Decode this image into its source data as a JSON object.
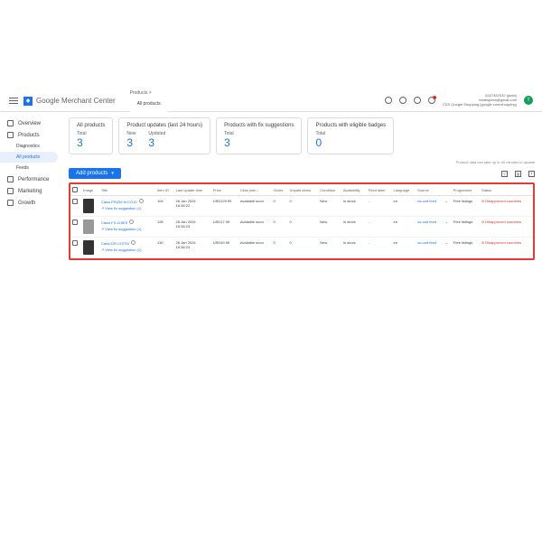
{
  "header": {
    "app_title": "Google Merchant Center",
    "breadcrumb_parent": "Products >",
    "breadcrumb_current": "All products",
    "account_id": "5327452032 (pinta)",
    "account_email": "testespinta@gmail.com",
    "account_program": "CSS Google Shopping (google.com/shopping)",
    "avatar_letter": "T"
  },
  "sidebar": {
    "overview": "Overview",
    "products": "Products",
    "diagnostics": "Diagnostics",
    "all_products": "All products",
    "feeds": "Feeds",
    "performance": "Performance",
    "marketing": "Marketing",
    "growth": "Growth"
  },
  "cards": [
    {
      "title": "All products",
      "cols": [
        {
          "sub": "Total",
          "num": "3"
        }
      ]
    },
    {
      "title": "Product updates (last 24 hours)",
      "cols": [
        {
          "sub": "New",
          "num": "3"
        },
        {
          "sub": "Updated",
          "num": "3"
        }
      ]
    },
    {
      "title": "Products with fix suggestions",
      "cols": [
        {
          "sub": "Total",
          "num": "3"
        }
      ]
    },
    {
      "title": "Products with eligible badges",
      "cols": [
        {
          "sub": "Total",
          "num": "0"
        }
      ]
    }
  ],
  "notice": "Product data can take up to 30 minutes to update",
  "toolbar": {
    "add": "Add products"
  },
  "columns": [
    "",
    "Image",
    "Title",
    "Item ID",
    "Last update time",
    "Price",
    "Click potn ↓",
    "Clicks",
    "Unpaid clicks",
    "Condition",
    "Availability",
    "Feed label",
    "Language",
    "Source",
    "",
    "Programme",
    "Status"
  ],
  "fix_suggestion": "↗ View fix suggestion (1)",
  "rows": [
    {
      "title": "Casio PRIZM fx-CG10",
      "id": "104",
      "date": "26 Jan 2024",
      "time": "16:38:22",
      "price": "USD129.99",
      "potn": "Available soon",
      "clicks": "0",
      "unpaid": "0",
      "cond": "New",
      "avail": "In stock",
      "lang": "en",
      "src": "cs-cart feed",
      "prog": "Free listings",
      "status": "Disapproved countries"
    },
    {
      "title": "Casio FX-115ES",
      "id": "128",
      "date": "26 Jan 2024",
      "time": "16:38:23",
      "price": "USD17.99",
      "potn": "Available soon",
      "clicks": "0",
      "unpaid": "0",
      "cond": "New",
      "avail": "In stock",
      "lang": "en",
      "src": "cs-cart feed",
      "prog": "Free listings",
      "status": "Disapproved countries"
    },
    {
      "title": "Casio DR-210TM",
      "id": "130",
      "date": "26 Jan 2024",
      "time": "16:38:23",
      "price": "USD49.95",
      "potn": "Available soon",
      "clicks": "0",
      "unpaid": "0",
      "cond": "New",
      "avail": "In stock",
      "lang": "en",
      "src": "cs-cart feed",
      "prog": "Free listings",
      "status": "Disapproved countries"
    }
  ]
}
